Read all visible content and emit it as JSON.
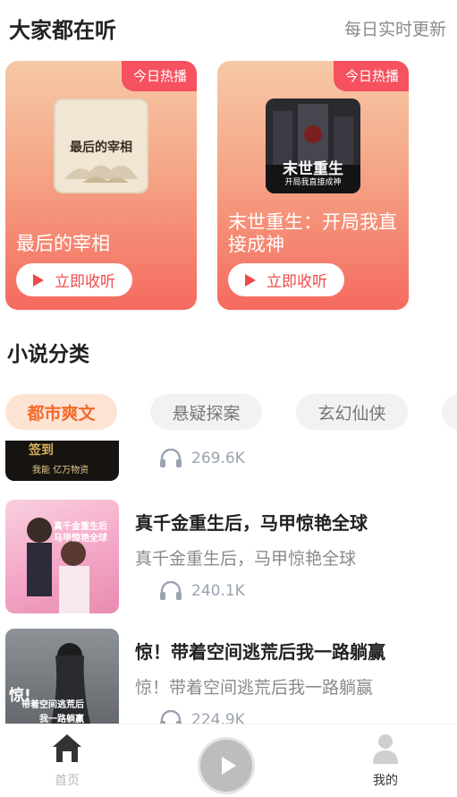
{
  "header": {
    "title": "大家都在听",
    "subtitle": "每日实时更新"
  },
  "hot": [
    {
      "tag": "今日热播",
      "cover_text": "最后的宰相",
      "name": "最后的宰相",
      "button": "立即收听"
    },
    {
      "tag": "今日热播",
      "cover_text_main": "末世重生",
      "cover_text_sub": "开局我直接成神",
      "name": "末世重生：开局我直接成神",
      "button": "立即收听"
    }
  ],
  "section": {
    "title": "小说分类"
  },
  "categories": [
    {
      "label": "都市爽文",
      "active": true
    },
    {
      "label": "悬疑探案",
      "active": false
    },
    {
      "label": "玄幻仙侠",
      "active": false
    }
  ],
  "list": [
    {
      "title": "",
      "desc": "",
      "plays": "269.6K",
      "cover_text_top": "签到",
      "cover_text_bottom": "我能 亿万物资"
    },
    {
      "title": "真千金重生后，马甲惊艳全球",
      "desc": "真千金重生后，马甲惊艳全球",
      "plays": "240.1K",
      "cover_text": "真千金重生后 马甲惊艳全球"
    },
    {
      "title": "惊！带着空间逃荒后我一路躺赢",
      "desc": "惊！带着空间逃荒后我一路躺赢",
      "plays": "224.9K",
      "cover_text_top": "惊!",
      "cover_text_mid": "带着空间逃荒后",
      "cover_text_bottom": "我一路躺赢"
    }
  ],
  "tabbar": {
    "home": "首页",
    "mine": "我的"
  },
  "colors": {
    "accent": "#f04b4b",
    "tag_bg": "#f5515f",
    "active_tab_text": "#f26a2c",
    "active_tab_bg": "#fde3d3"
  }
}
